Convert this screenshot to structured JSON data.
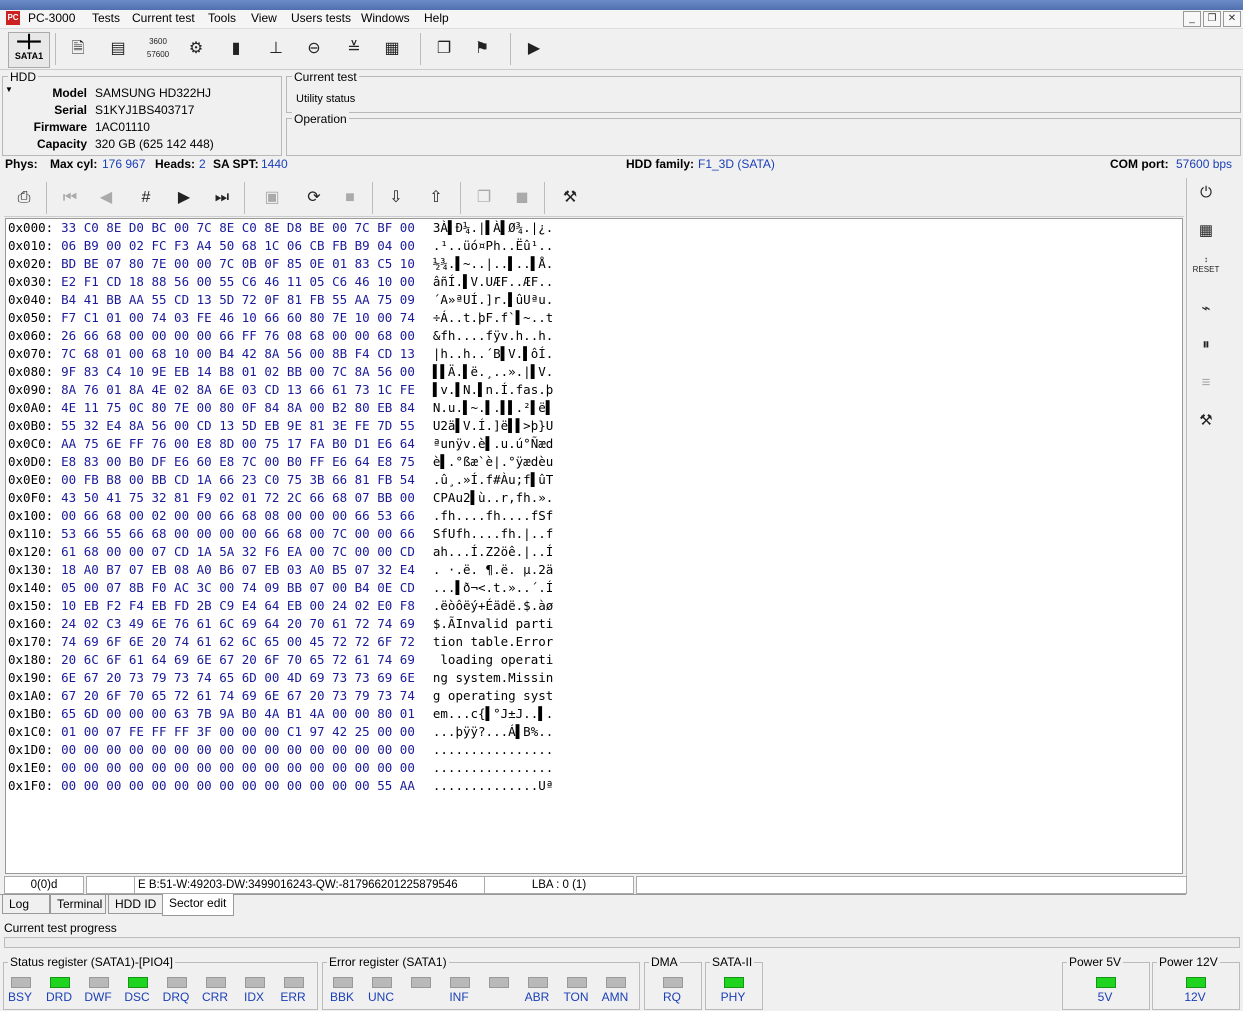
{
  "app": {
    "title": "PC-3000"
  },
  "menu": [
    "Tests",
    "Current test",
    "Tools",
    "View",
    "Users tests",
    "Windows",
    "Help"
  ],
  "toolbar": {
    "sata_label": "SATA1"
  },
  "hdd": {
    "group_label": "HDD",
    "model_label": "Model",
    "model": "SAMSUNG HD322HJ",
    "serial_label": "Serial",
    "serial": "S1KYJ1BS403717",
    "firmware_label": "Firmware",
    "firmware": "1AC01110",
    "capacity_label": "Capacity",
    "capacity": "320 GB (625 142 448)"
  },
  "current_test": {
    "group_label": "Current test",
    "value": "Utility status"
  },
  "operation": {
    "group_label": "Operation",
    "value": ""
  },
  "phys": {
    "phys_label": "Phys:",
    "maxcyl_label": "Max cyl:",
    "maxcyl": "176 967",
    "heads_label": "Heads:",
    "heads": "2",
    "saspt_label": "SA SPT:",
    "saspt": "1440",
    "family_label": "HDD family:",
    "family": "F1_3D (SATA)",
    "com_label": "COM port:",
    "com": "57600 bps"
  },
  "hex_rows": [
    {
      "off": "0x000:",
      "bytes": "33 C0 8E D0 BC 00 7C 8E C0 8E D8 BE 00 7C BF 00",
      "ascii": "3À▌Ð¼.|▌À▌Ø¾.|¿."
    },
    {
      "off": "0x010:",
      "bytes": "06 B9 00 02 FC F3 A4 50 68 1C 06 CB FB B9 04 00",
      "ascii": ".¹..üó¤Ph..Ëû¹.."
    },
    {
      "off": "0x020:",
      "bytes": "BD BE 07 80 7E 00 00 7C 0B 0F 85 0E 01 83 C5 10",
      "ascii": "½¾.▌~..|..▌..▌Å."
    },
    {
      "off": "0x030:",
      "bytes": "E2 F1 CD 18 88 56 00 55 C6 46 11 05 C6 46 10 00",
      "ascii": "âñÍ.▌V.UÆF..ÆF.."
    },
    {
      "off": "0x040:",
      "bytes": "B4 41 BB AA 55 CD 13 5D 72 0F 81 FB 55 AA 75 09",
      "ascii": "´A»ªUÍ.]r.▌ûUªu."
    },
    {
      "off": "0x050:",
      "bytes": "F7 C1 01 00 74 03 FE 46 10 66 60 80 7E 10 00 74",
      "ascii": "÷Á..t.þF.f`▌~..t"
    },
    {
      "off": "0x060:",
      "bytes": "26 66 68 00 00 00 00 66 FF 76 08 68 00 00 68 00",
      "ascii": "&fh....fÿv.h..h."
    },
    {
      "off": "0x070:",
      "bytes": "7C 68 01 00 68 10 00 B4 42 8A 56 00 8B F4 CD 13",
      "ascii": "|h..h..´B▌V.▌ôÍ."
    },
    {
      "off": "0x080:",
      "bytes": "9F 83 C4 10 9E EB 14 B8 01 02 BB 00 7C 8A 56 00",
      "ascii": "▌▌Ä.▌ë.¸..».|▌V."
    },
    {
      "off": "0x090:",
      "bytes": "8A 76 01 8A 4E 02 8A 6E 03 CD 13 66 61 73 1C FE",
      "ascii": "▌v.▌N.▌n.Í.fas.þ"
    },
    {
      "off": "0x0A0:",
      "bytes": "4E 11 75 0C 80 7E 00 80 0F 84 8A 00 B2 80 EB 84",
      "ascii": "N.u.▌~.▌.▌▌.²▌ë▌"
    },
    {
      "off": "0x0B0:",
      "bytes": "55 32 E4 8A 56 00 CD 13 5D EB 9E 81 3E FE 7D 55",
      "ascii": "U2ä▌V.Í.]ë▌▌>þ}U"
    },
    {
      "off": "0x0C0:",
      "bytes": "AA 75 6E FF 76 00 E8 8D 00 75 17 FA B0 D1 E6 64",
      "ascii": "ªunÿv.è▌.u.ú°Ñæd"
    },
    {
      "off": "0x0D0:",
      "bytes": "E8 83 00 B0 DF E6 60 E8 7C 00 B0 FF E6 64 E8 75",
      "ascii": "è▌.°ßæ`è|.°ÿædèu"
    },
    {
      "off": "0x0E0:",
      "bytes": "00 FB B8 00 BB CD 1A 66 23 C0 75 3B 66 81 FB 54",
      "ascii": ".û¸.»Í.f#Àu;f▌ûT"
    },
    {
      "off": "0x0F0:",
      "bytes": "43 50 41 75 32 81 F9 02 01 72 2C 66 68 07 BB 00",
      "ascii": "CPAu2▌ù..r,fh.»."
    },
    {
      "off": "0x100:",
      "bytes": "00 66 68 00 02 00 00 66 68 08 00 00 00 66 53 66",
      "ascii": ".fh....fh....fSf"
    },
    {
      "off": "0x110:",
      "bytes": "53 66 55 66 68 00 00 00 00 66 68 00 7C 00 00 66",
      "ascii": "SfUfh....fh.|..f"
    },
    {
      "off": "0x120:",
      "bytes": "61 68 00 00 07 CD 1A 5A 32 F6 EA 00 7C 00 00 CD",
      "ascii": "ah...Í.Z2öê.|..Í"
    },
    {
      "off": "0x130:",
      "bytes": "18 A0 B7 07 EB 08 A0 B6 07 EB 03 A0 B5 07 32 E4",
      "ascii": ". ·.ë. ¶.ë. µ.2ä"
    },
    {
      "off": "0x140:",
      "bytes": "05 00 07 8B F0 AC 3C 00 74 09 BB 07 00 B4 0E CD",
      "ascii": "...▌ð¬<.t.»..´.Í"
    },
    {
      "off": "0x150:",
      "bytes": "10 EB F2 F4 EB FD 2B C9 E4 64 EB 00 24 02 E0 F8",
      "ascii": ".ëòôëý+Éädë.$.àø"
    },
    {
      "off": "0x160:",
      "bytes": "24 02 C3 49 6E 76 61 6C 69 64 20 70 61 72 74 69",
      "ascii": "$.ÃInvalid parti"
    },
    {
      "off": "0x170:",
      "bytes": "74 69 6F 6E 20 74 61 62 6C 65 00 45 72 72 6F 72",
      "ascii": "tion table.Error"
    },
    {
      "off": "0x180:",
      "bytes": "20 6C 6F 61 64 69 6E 67 20 6F 70 65 72 61 74 69",
      "ascii": " loading operati"
    },
    {
      "off": "0x190:",
      "bytes": "6E 67 20 73 79 73 74 65 6D 00 4D 69 73 73 69 6E",
      "ascii": "ng system.Missin"
    },
    {
      "off": "0x1A0:",
      "bytes": "67 20 6F 70 65 72 61 74 69 6E 67 20 73 79 73 74",
      "ascii": "g operating syst"
    },
    {
      "off": "0x1B0:",
      "bytes": "65 6D 00 00 00 63 7B 9A B0 4A B1 4A 00 00 80 01",
      "ascii": "em...c{▌°J±J..▌."
    },
    {
      "off": "0x1C0:",
      "bytes": "01 00 07 FE FF FF 3F 00 00 00 C1 97 42 25 00 00",
      "ascii": "...þÿÿ?...Á▌B%.."
    },
    {
      "off": "0x1D0:",
      "bytes": "00 00 00 00 00 00 00 00 00 00 00 00 00 00 00 00",
      "ascii": "................"
    },
    {
      "off": "0x1E0:",
      "bytes": "00 00 00 00 00 00 00 00 00 00 00 00 00 00 00 00",
      "ascii": "................"
    },
    {
      "off": "0x1F0:",
      "bytes": "00 00 00 00 00 00 00 00 00 00 00 00 00 00 55 AA",
      "ascii": "..............Uª"
    }
  ],
  "statusbar": {
    "position": "0(0)d",
    "info": "E B:51-W:49203-DW:3499016243-QW:-8179662012258795​46",
    "lba": "LBA : 0 (1)"
  },
  "tabs": [
    "Log",
    "Terminal",
    "HDD ID",
    "Sector edit"
  ],
  "progress": {
    "label": "Current test progress",
    "value": 0
  },
  "registers": {
    "status_title": "Status register (SATA1)-[PIO4]",
    "status_leds": [
      {
        "name": "BSY",
        "on": false
      },
      {
        "name": "DRD",
        "on": true
      },
      {
        "name": "DWF",
        "on": false
      },
      {
        "name": "DSC",
        "on": true
      },
      {
        "name": "DRQ",
        "on": false
      },
      {
        "name": "CRR",
        "on": false
      },
      {
        "name": "IDX",
        "on": false
      },
      {
        "name": "ERR",
        "on": false
      }
    ],
    "error_title": "Error register (SATA1)",
    "error_leds": [
      {
        "name": "BBK",
        "on": false
      },
      {
        "name": "UNC",
        "on": false
      },
      {
        "name": "",
        "on": false
      },
      {
        "name": "INF",
        "on": false
      },
      {
        "name": "",
        "on": false
      },
      {
        "name": "ABR",
        "on": false
      },
      {
        "name": "TON",
        "on": false
      },
      {
        "name": "AMN",
        "on": false
      }
    ],
    "dma_title": "DMA",
    "dma_led": {
      "name": "RQ",
      "on": false
    },
    "sata_title": "SATA-II",
    "sata_led": {
      "name": "PHY",
      "on": true
    },
    "p5_title": "Power 5V",
    "p5_led": {
      "name": "5V",
      "on": true
    },
    "p12_title": "Power 12V",
    "p12_led": {
      "name": "12V",
      "on": true
    }
  },
  "colors": {
    "led_on": "#1fd41f",
    "led_off": "#b9b9b9",
    "value_blue": "#1a3fb6"
  }
}
